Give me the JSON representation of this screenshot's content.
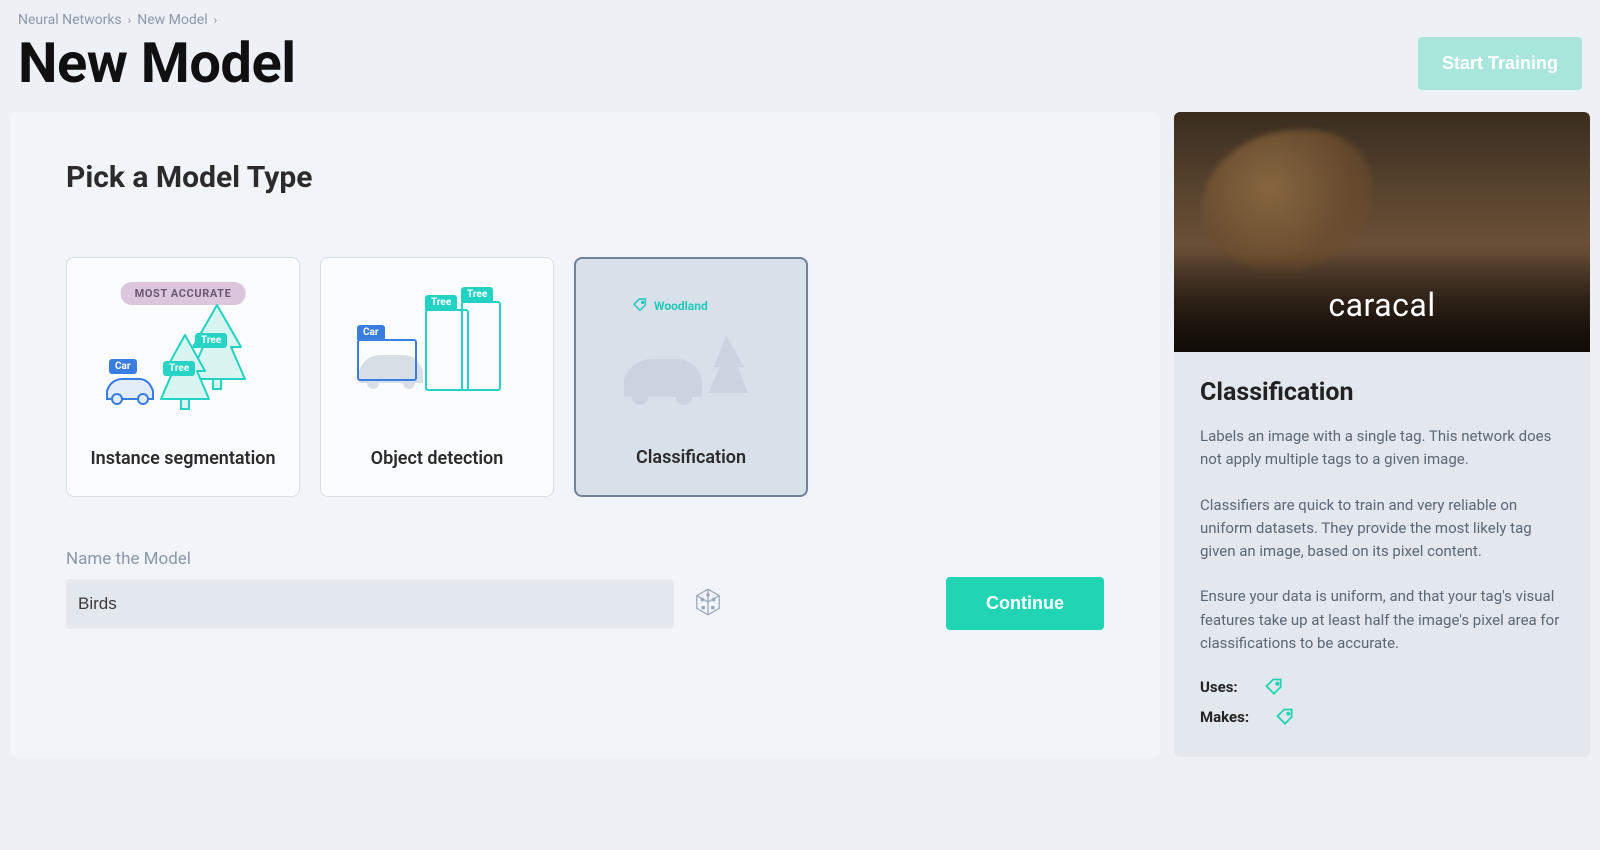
{
  "breadcrumb": {
    "items": [
      "Neural Networks",
      "New Model"
    ]
  },
  "header": {
    "page_title": "New Model",
    "start_training_label": "Start Training"
  },
  "picker": {
    "section_title": "Pick a Model Type",
    "cards": {
      "instance_segmentation": {
        "label": "Instance segmentation",
        "badge": "MOST ACCURATE",
        "illus_labels": {
          "car": "Car",
          "tree1": "Tree",
          "tree2": "Tree"
        },
        "selected": false
      },
      "object_detection": {
        "label": "Object detection",
        "illus_labels": {
          "car": "Car",
          "tree1": "Tree",
          "tree2": "Tree"
        },
        "selected": false
      },
      "classification": {
        "label": "Classification",
        "illus_tag_label": "Woodland",
        "selected": true
      }
    }
  },
  "name": {
    "label": "Name the Model",
    "value": "Birds"
  },
  "actions": {
    "continue_label": "Continue"
  },
  "side": {
    "image_caption": "caracal",
    "title": "Classification",
    "para1": "Labels an image with a single tag. This network does not apply multiple tags to a given image.",
    "para2": "Classifiers are quick to train and very reliable on uniform datasets. They provide the most likely tag given an image, based on its pixel content.",
    "para3": "Ensure your data is uniform, and that your tag's visual features take up at least half the image's pixel area for classifications to be accurate.",
    "uses_label": "Uses:",
    "makes_label": "Makes:"
  },
  "colors": {
    "accent": "#21d4b4",
    "accent_light": "#a8e6dc",
    "badge_bg": "#dcc6de"
  }
}
